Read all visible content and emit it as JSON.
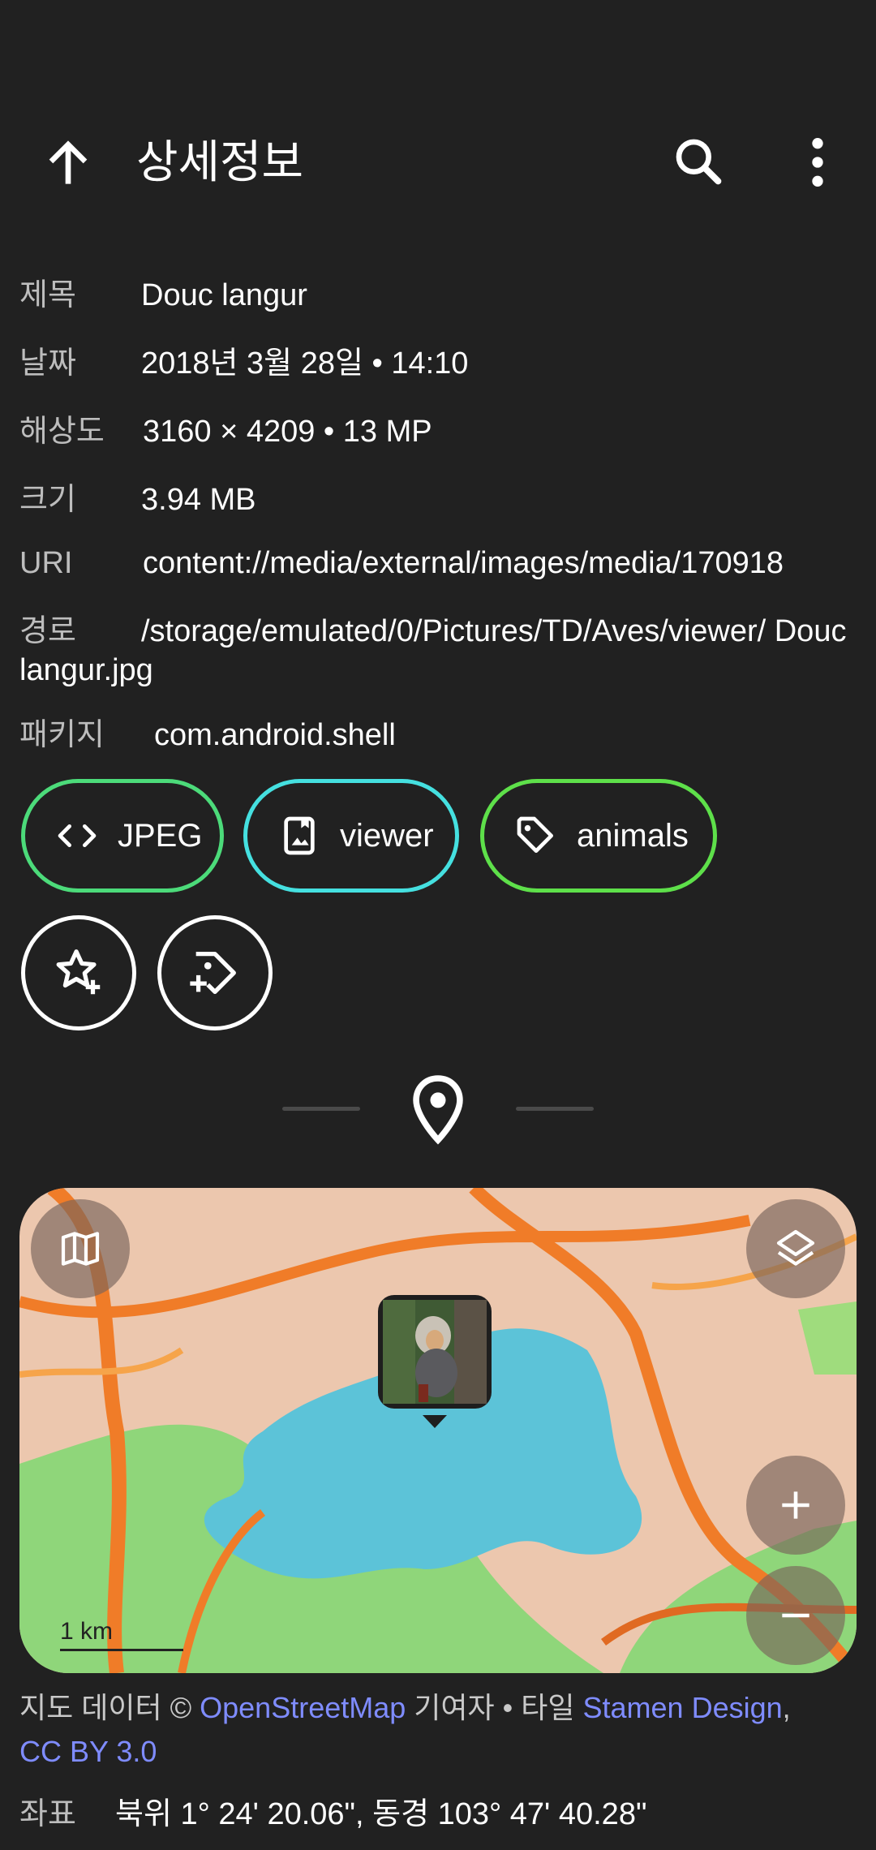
{
  "header": {
    "title": "상세정보"
  },
  "details": {
    "title_key": "제목",
    "title_val": "Douc langur",
    "date_key": "날짜",
    "date_val": "2018년 3월 28일 • 14:10",
    "res_key": "해상도",
    "res_val": "3160 × 4209 • 13 MP",
    "size_key": "크기",
    "size_val": "3.94 MB",
    "uri_key": "URI",
    "uri_val": "content://media/external/images/media/170918",
    "path_key": "경로",
    "path_val": "/storage/emulated/0/Pictures/TD/Aves/viewer/ Douc langur.jpg",
    "pkg_key": "패키지",
    "pkg_val": "com.android.shell"
  },
  "chips": [
    {
      "label": "JPEG",
      "color": "#4cdb7a",
      "icon": "code-icon"
    },
    {
      "label": "viewer",
      "color": "#45e0e0",
      "icon": "album-icon"
    },
    {
      "label": "animals",
      "color": "#5ee04a",
      "icon": "tag-icon"
    }
  ],
  "map": {
    "scale_label": "1 km"
  },
  "attribution": {
    "prefix": "지도 데이터 © ",
    "osm": "OpenStreetMap",
    "middle": " 기여자 • 타일 ",
    "stamen": "Stamen Design",
    "comma": ",",
    "license": "CC BY 3.0"
  },
  "coordinates": {
    "key": "좌표",
    "value": "북위 1° 24' 20.06\", 동경 103° 47' 40.28\""
  }
}
